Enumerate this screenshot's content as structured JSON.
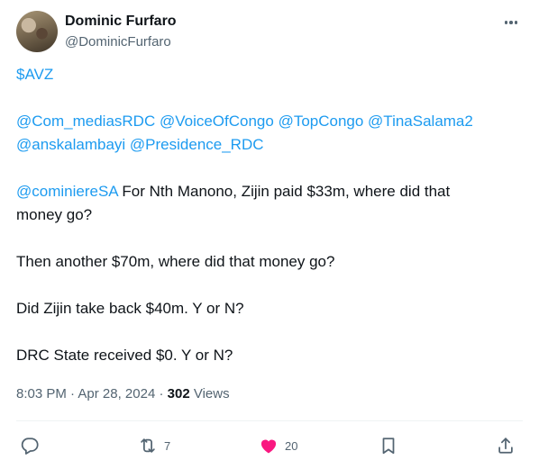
{
  "author": {
    "display_name": "Dominic Furfaro",
    "handle": "@DominicFurfaro"
  },
  "tweet": {
    "cashtag": "$AVZ",
    "mentions_line1": "@Com_mediasRDC @VoiceOfCongo @TopCongo @TinaSalama2",
    "mentions_line2": "@anskalambayi @Presidence_RDC",
    "reply_mention": "@cominiereSA",
    "para1_rest_a": " For Nth Manono, Zijin paid $33m, where did that",
    "para1_rest_b": "money go?",
    "para2": "Then another $70m, where did that money go?",
    "para3": "Did Zijin take back $40m. Y or N?",
    "para4": "DRC State received $0. Y or N?"
  },
  "meta": {
    "time": "8:03 PM",
    "separator": "·",
    "date": "Apr 28, 2024",
    "views_count": "302",
    "views_label": "Views"
  },
  "actions": {
    "reply_icon": "reply-icon",
    "retweet_icon": "retweet-icon",
    "retweet_count": "7",
    "like_icon": "heart-filled-icon",
    "like_count": "20",
    "like_color": "#f91880",
    "bookmark_icon": "bookmark-icon",
    "share_icon": "share-icon"
  },
  "colors": {
    "link": "#1d9bf0",
    "text": "#0f1419",
    "secondary": "#536471"
  }
}
